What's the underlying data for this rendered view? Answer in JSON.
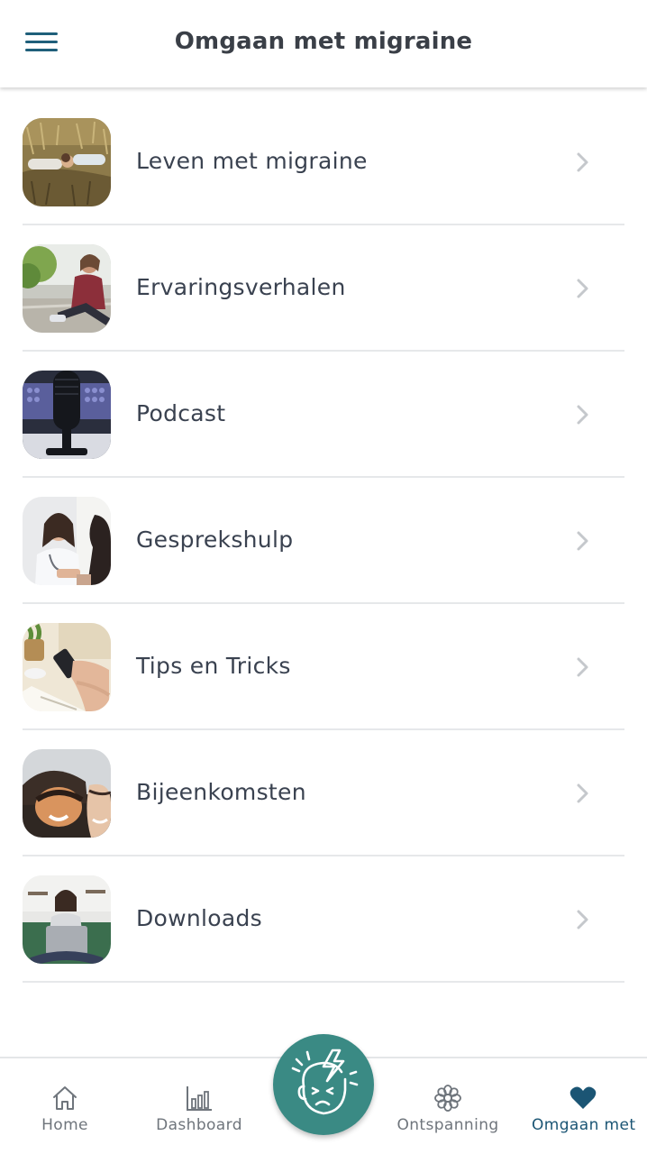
{
  "header": {
    "title": "Omgaan met migraine",
    "menu_icon": "hamburger-menu-icon"
  },
  "list": {
    "items": [
      {
        "label": "Leven met migraine",
        "thumb": "people-lying-in-grass-photo"
      },
      {
        "label": "Ervaringsverhalen",
        "thumb": "woman-stretching-outdoors-photo"
      },
      {
        "label": "Podcast",
        "thumb": "podcast-microphone-photo"
      },
      {
        "label": "Gesprekshulp",
        "thumb": "doctor-consultation-photo"
      },
      {
        "label": "Tips en Tricks",
        "thumb": "hands-with-phone-and-notebook-photo"
      },
      {
        "label": "Bijeenkomsten",
        "thumb": "women-laughing-photo"
      },
      {
        "label": "Downloads",
        "thumb": "woman-with-laptop-photo"
      }
    ]
  },
  "bottom_nav": {
    "items": [
      {
        "label": "Home",
        "icon": "home-icon"
      },
      {
        "label": "Dashboard",
        "icon": "bar-chart-icon"
      },
      {
        "label": "Ontspanning",
        "icon": "flower-icon"
      },
      {
        "label": "Omgaan met",
        "icon": "heart-icon",
        "active": true
      }
    ],
    "center_button_icon": "migraine-head-icon"
  },
  "colors": {
    "accent": "#1b5574",
    "fab": "#3a8a84",
    "divider": "#e6e8ea",
    "text": "#3a4250"
  }
}
